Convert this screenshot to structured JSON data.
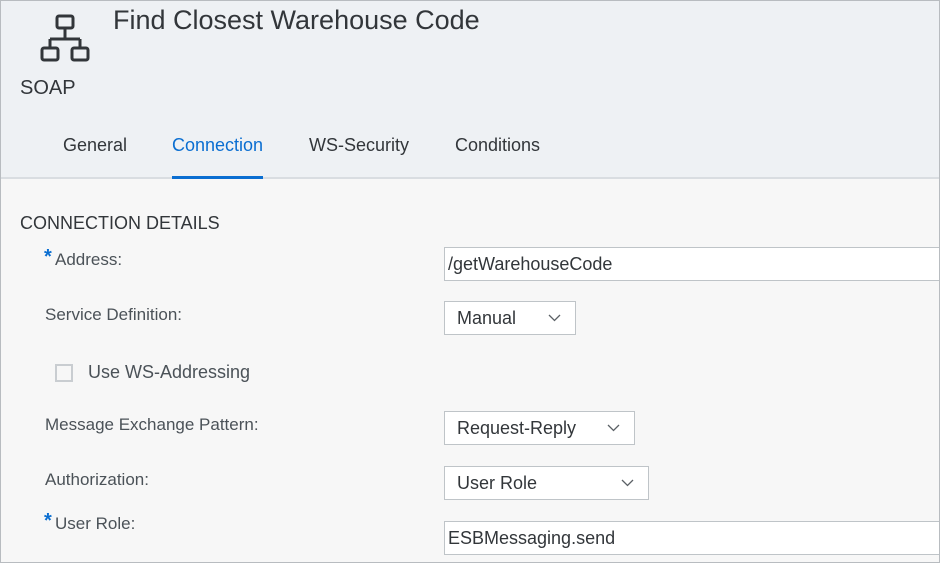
{
  "header": {
    "title": "Find Closest Warehouse Code",
    "type_label": "SOAP",
    "icon": "hierarchy-icon"
  },
  "tabs": [
    {
      "label": "General",
      "active": false
    },
    {
      "label": "Connection",
      "active": true
    },
    {
      "label": "WS-Security",
      "active": false
    },
    {
      "label": "Conditions",
      "active": false
    }
  ],
  "section": {
    "title": "CONNECTION DETAILS"
  },
  "fields": {
    "address": {
      "required_mark": "*",
      "label": "Address:",
      "value": "/getWarehouseCode"
    },
    "service_definition": {
      "label": "Service Definition:",
      "value": "Manual"
    },
    "ws_addressing": {
      "label": "Use WS-Addressing",
      "checked": false
    },
    "message_exchange_pattern": {
      "label": "Message Exchange Pattern:",
      "value": "Request-Reply"
    },
    "authorization": {
      "label": "Authorization:",
      "value": "User Role"
    },
    "user_role": {
      "required_mark": "*",
      "label": "User Role:",
      "value": "ESBMessaging.send"
    }
  },
  "colors": {
    "accent": "#0a6ed1",
    "header_bg": "#eef1f4",
    "text": "#32363a"
  }
}
